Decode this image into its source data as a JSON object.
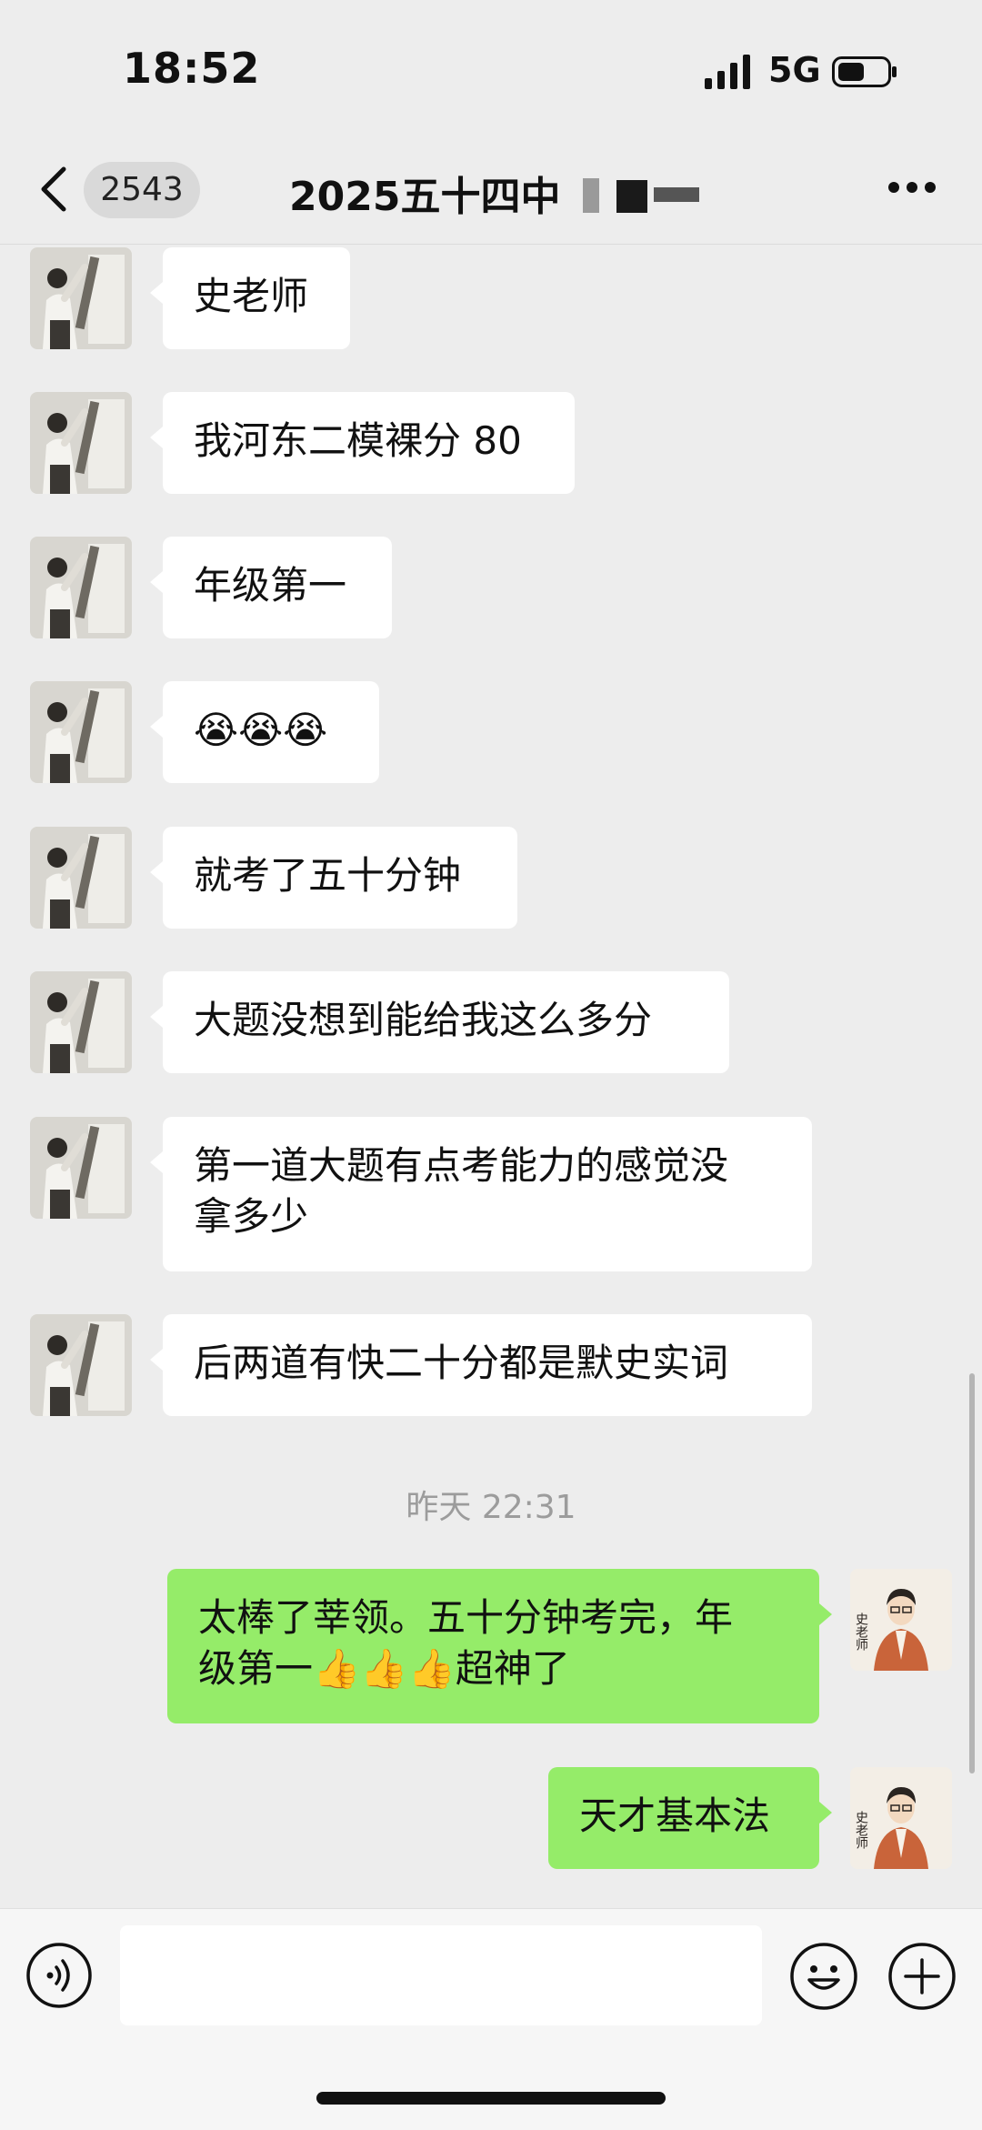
{
  "status_bar": {
    "time": "18:52",
    "network": "5G"
  },
  "nav": {
    "unread_count": "2543",
    "title": "2025五十四中"
  },
  "messages": [
    {
      "side": "left",
      "text": "史老师"
    },
    {
      "side": "left",
      "text": "我河东二模裸分 80"
    },
    {
      "side": "left",
      "text": "年级第一"
    },
    {
      "side": "left",
      "text": "😭😭😭"
    },
    {
      "side": "left",
      "text": "就考了五十分钟"
    },
    {
      "side": "left",
      "text": "大题没想到能给我这么多分"
    },
    {
      "side": "left",
      "text": "第一道大题有点考能力的感觉没\n拿多少"
    },
    {
      "side": "left",
      "text": "后两道有快二十分都是默史实词"
    },
    {
      "side": "right",
      "text": "太棒了莘领。五十分钟考完，年\n级第一👍👍👍超神了"
    },
    {
      "side": "right",
      "text": "天才基本法"
    }
  ],
  "timestamp": "昨天 22:31",
  "avatar_caption": "史老师",
  "colors": {
    "background": "#EDEDED",
    "incoming_bubble": "#FFFFFF",
    "outgoing_bubble": "#95EC69"
  },
  "icons": [
    "back-icon",
    "more-icon",
    "voice-icon",
    "emoji-icon",
    "plus-icon"
  ]
}
